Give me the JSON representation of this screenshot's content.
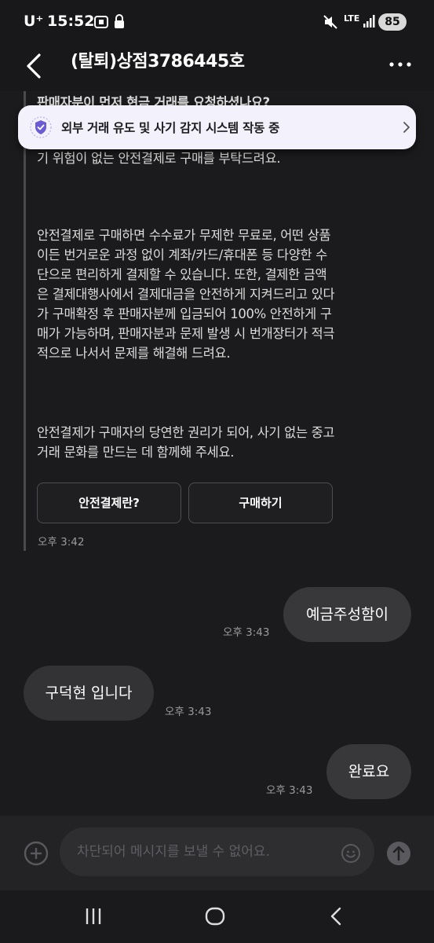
{
  "status_bar": {
    "carrier": "U⁺",
    "time": "15:52",
    "network": "LTE",
    "battery": "85"
  },
  "header": {
    "title": "(탈퇴)상점3786445호"
  },
  "banner": {
    "text": "외부 거래 유도 및 사기 감지 시스템 작동 중"
  },
  "system_message": {
    "partial_top": "판매자분이 먼저 현금 거래를 요청하셨나요?",
    "paragraph1": "구매할 수 있어요. 판매자분이 현금 거래를 요청해도, 사기 위험이 없는 안전결제로 구매를 부탁드려요.",
    "paragraph2": "안전결제로 구매하면 수수료가 무제한 무료로, 어떤 상품이든 번거로운 과정 없이 계좌/카드/휴대폰 등 다양한 수단으로 편리하게 결제할 수 있습니다. 또한, 결제한 금액은 결제대행사에서 결제대금을 안전하게 지켜드리고 있다가 구매확정 후 판매자분께 입금되어 100% 안전하게 구매가 가능하며, 판매자분과 문제 발생 시 번개장터가 적극적으로 나서서 문제를 해결해 드려요.",
    "paragraph3": "안전결제가 구매자의 당연한 권리가 되어, 사기 없는 중고거래 문화를 만드는 데 함께해 주세요.",
    "button_info": "안전결제란?",
    "button_buy": "구매하기",
    "time": "오후 3:42"
  },
  "messages": [
    {
      "side": "mine",
      "text": "예금주성함이",
      "time": "오후 3:43"
    },
    {
      "side": "theirs",
      "text": "구덕현 입니다",
      "time": "오후 3:43"
    },
    {
      "side": "mine",
      "text": "완료요",
      "time": "오후 3:43"
    }
  ],
  "input": {
    "placeholder": "차단되어 메시지를 보낼 수 없어요."
  },
  "colors": {
    "background": "#1b1b1d",
    "bubble": "#333336",
    "banner_bg": "#f3f1fb",
    "shield": "#6b5cd6"
  }
}
